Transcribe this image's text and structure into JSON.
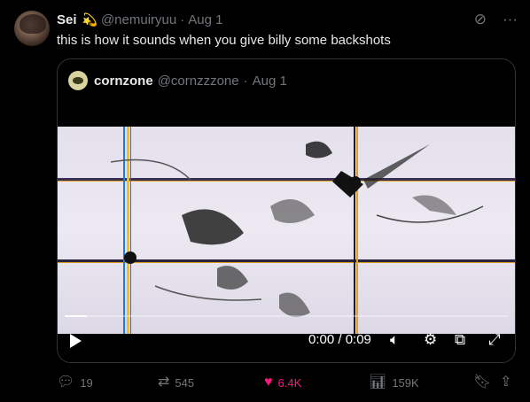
{
  "post": {
    "author_name": "Sei",
    "author_emoji": "💫",
    "handle": "@nemuiryuu",
    "separator": "·",
    "date": "Aug 1",
    "text": "this is how it sounds when you give billy some backshots",
    "grok_icon": "slash-circle-icon",
    "more_icon": "more-icon"
  },
  "quote": {
    "author_name": "cornzone",
    "handle": "@cornzzzone",
    "separator": "·",
    "date": "Aug 1"
  },
  "video": {
    "time_display": "0:00 / 0:09",
    "progress": 0.05,
    "icons": [
      "play-icon",
      "volume-icon",
      "settings-icon",
      "pip-icon",
      "fullscreen-icon"
    ]
  },
  "actions": {
    "replies": "19",
    "reposts": "545",
    "likes": "6.4K",
    "views": "159K",
    "like_color": "#f91880"
  }
}
